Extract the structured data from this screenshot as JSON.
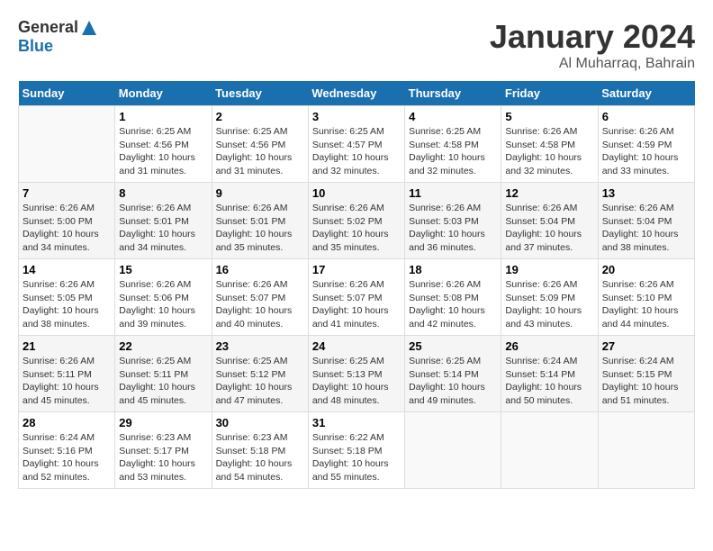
{
  "header": {
    "logo_general": "General",
    "logo_blue": "Blue",
    "title": "January 2024",
    "location": "Al Muharraq, Bahrain"
  },
  "columns": [
    "Sunday",
    "Monday",
    "Tuesday",
    "Wednesday",
    "Thursday",
    "Friday",
    "Saturday"
  ],
  "weeks": [
    [
      {
        "day": "",
        "sunrise": "",
        "sunset": "",
        "daylight": ""
      },
      {
        "day": "1",
        "sunrise": "Sunrise: 6:25 AM",
        "sunset": "Sunset: 4:56 PM",
        "daylight": "Daylight: 10 hours and 31 minutes."
      },
      {
        "day": "2",
        "sunrise": "Sunrise: 6:25 AM",
        "sunset": "Sunset: 4:56 PM",
        "daylight": "Daylight: 10 hours and 31 minutes."
      },
      {
        "day": "3",
        "sunrise": "Sunrise: 6:25 AM",
        "sunset": "Sunset: 4:57 PM",
        "daylight": "Daylight: 10 hours and 32 minutes."
      },
      {
        "day": "4",
        "sunrise": "Sunrise: 6:25 AM",
        "sunset": "Sunset: 4:58 PM",
        "daylight": "Daylight: 10 hours and 32 minutes."
      },
      {
        "day": "5",
        "sunrise": "Sunrise: 6:26 AM",
        "sunset": "Sunset: 4:58 PM",
        "daylight": "Daylight: 10 hours and 32 minutes."
      },
      {
        "day": "6",
        "sunrise": "Sunrise: 6:26 AM",
        "sunset": "Sunset: 4:59 PM",
        "daylight": "Daylight: 10 hours and 33 minutes."
      }
    ],
    [
      {
        "day": "7",
        "sunrise": "Sunrise: 6:26 AM",
        "sunset": "Sunset: 5:00 PM",
        "daylight": "Daylight: 10 hours and 34 minutes."
      },
      {
        "day": "8",
        "sunrise": "Sunrise: 6:26 AM",
        "sunset": "Sunset: 5:01 PM",
        "daylight": "Daylight: 10 hours and 34 minutes."
      },
      {
        "day": "9",
        "sunrise": "Sunrise: 6:26 AM",
        "sunset": "Sunset: 5:01 PM",
        "daylight": "Daylight: 10 hours and 35 minutes."
      },
      {
        "day": "10",
        "sunrise": "Sunrise: 6:26 AM",
        "sunset": "Sunset: 5:02 PM",
        "daylight": "Daylight: 10 hours and 35 minutes."
      },
      {
        "day": "11",
        "sunrise": "Sunrise: 6:26 AM",
        "sunset": "Sunset: 5:03 PM",
        "daylight": "Daylight: 10 hours and 36 minutes."
      },
      {
        "day": "12",
        "sunrise": "Sunrise: 6:26 AM",
        "sunset": "Sunset: 5:04 PM",
        "daylight": "Daylight: 10 hours and 37 minutes."
      },
      {
        "day": "13",
        "sunrise": "Sunrise: 6:26 AM",
        "sunset": "Sunset: 5:04 PM",
        "daylight": "Daylight: 10 hours and 38 minutes."
      }
    ],
    [
      {
        "day": "14",
        "sunrise": "Sunrise: 6:26 AM",
        "sunset": "Sunset: 5:05 PM",
        "daylight": "Daylight: 10 hours and 38 minutes."
      },
      {
        "day": "15",
        "sunrise": "Sunrise: 6:26 AM",
        "sunset": "Sunset: 5:06 PM",
        "daylight": "Daylight: 10 hours and 39 minutes."
      },
      {
        "day": "16",
        "sunrise": "Sunrise: 6:26 AM",
        "sunset": "Sunset: 5:07 PM",
        "daylight": "Daylight: 10 hours and 40 minutes."
      },
      {
        "day": "17",
        "sunrise": "Sunrise: 6:26 AM",
        "sunset": "Sunset: 5:07 PM",
        "daylight": "Daylight: 10 hours and 41 minutes."
      },
      {
        "day": "18",
        "sunrise": "Sunrise: 6:26 AM",
        "sunset": "Sunset: 5:08 PM",
        "daylight": "Daylight: 10 hours and 42 minutes."
      },
      {
        "day": "19",
        "sunrise": "Sunrise: 6:26 AM",
        "sunset": "Sunset: 5:09 PM",
        "daylight": "Daylight: 10 hours and 43 minutes."
      },
      {
        "day": "20",
        "sunrise": "Sunrise: 6:26 AM",
        "sunset": "Sunset: 5:10 PM",
        "daylight": "Daylight: 10 hours and 44 minutes."
      }
    ],
    [
      {
        "day": "21",
        "sunrise": "Sunrise: 6:26 AM",
        "sunset": "Sunset: 5:11 PM",
        "daylight": "Daylight: 10 hours and 45 minutes."
      },
      {
        "day": "22",
        "sunrise": "Sunrise: 6:25 AM",
        "sunset": "Sunset: 5:11 PM",
        "daylight": "Daylight: 10 hours and 45 minutes."
      },
      {
        "day": "23",
        "sunrise": "Sunrise: 6:25 AM",
        "sunset": "Sunset: 5:12 PM",
        "daylight": "Daylight: 10 hours and 47 minutes."
      },
      {
        "day": "24",
        "sunrise": "Sunrise: 6:25 AM",
        "sunset": "Sunset: 5:13 PM",
        "daylight": "Daylight: 10 hours and 48 minutes."
      },
      {
        "day": "25",
        "sunrise": "Sunrise: 6:25 AM",
        "sunset": "Sunset: 5:14 PM",
        "daylight": "Daylight: 10 hours and 49 minutes."
      },
      {
        "day": "26",
        "sunrise": "Sunrise: 6:24 AM",
        "sunset": "Sunset: 5:14 PM",
        "daylight": "Daylight: 10 hours and 50 minutes."
      },
      {
        "day": "27",
        "sunrise": "Sunrise: 6:24 AM",
        "sunset": "Sunset: 5:15 PM",
        "daylight": "Daylight: 10 hours and 51 minutes."
      }
    ],
    [
      {
        "day": "28",
        "sunrise": "Sunrise: 6:24 AM",
        "sunset": "Sunset: 5:16 PM",
        "daylight": "Daylight: 10 hours and 52 minutes."
      },
      {
        "day": "29",
        "sunrise": "Sunrise: 6:23 AM",
        "sunset": "Sunset: 5:17 PM",
        "daylight": "Daylight: 10 hours and 53 minutes."
      },
      {
        "day": "30",
        "sunrise": "Sunrise: 6:23 AM",
        "sunset": "Sunset: 5:18 PM",
        "daylight": "Daylight: 10 hours and 54 minutes."
      },
      {
        "day": "31",
        "sunrise": "Sunrise: 6:22 AM",
        "sunset": "Sunset: 5:18 PM",
        "daylight": "Daylight: 10 hours and 55 minutes."
      },
      {
        "day": "",
        "sunrise": "",
        "sunset": "",
        "daylight": ""
      },
      {
        "day": "",
        "sunrise": "",
        "sunset": "",
        "daylight": ""
      },
      {
        "day": "",
        "sunrise": "",
        "sunset": "",
        "daylight": ""
      }
    ]
  ]
}
